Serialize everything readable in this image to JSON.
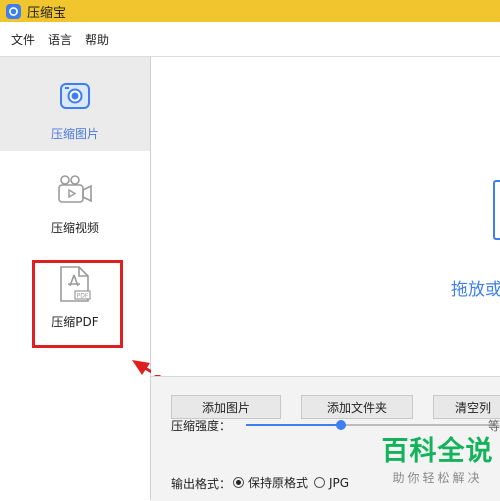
{
  "app": {
    "title": "压缩宝"
  },
  "menu": [
    "文件",
    "语言",
    "帮助"
  ],
  "sidebar": {
    "items": [
      {
        "label": "压缩图片",
        "icon": "camera-icon",
        "active": true
      },
      {
        "label": "压缩视频",
        "icon": "video-camera-icon",
        "active": false
      },
      {
        "label": "压缩PDF",
        "icon": "pdf-file-icon",
        "active": false
      }
    ]
  },
  "content": {
    "drop_text": "拖放或"
  },
  "buttons": {
    "add_images": "添加图片",
    "add_folder": "添加文件夹",
    "clear_list": "清空列"
  },
  "settings": {
    "strength_label": "压缩强度：",
    "strength_level_fraction": 0.38,
    "strength_value_text": "等",
    "format_label": "输出格式：",
    "format_options": [
      {
        "label": "保持原格式",
        "selected": true
      },
      {
        "label": "JPG",
        "selected": false
      }
    ]
  },
  "watermark": {
    "brand": "百科全说",
    "slogan": "助你轻松解决"
  },
  "colors": {
    "titlebar": "#f0c52e",
    "accent": "#3d7ff0",
    "highlight": "#e02020",
    "watermark": "#13b35b"
  }
}
